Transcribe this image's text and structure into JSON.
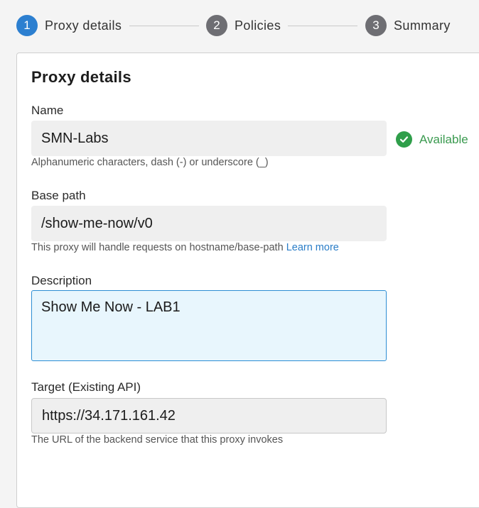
{
  "stepper": {
    "steps": [
      {
        "number": "1",
        "label": "Proxy details",
        "active": true
      },
      {
        "number": "2",
        "label": "Policies",
        "active": false
      },
      {
        "number": "3",
        "label": "Summary",
        "active": false
      }
    ]
  },
  "card": {
    "title": "Proxy details",
    "name": {
      "label": "Name",
      "value": "SMN-Labs",
      "hint": "Alphanumeric characters, dash (-) or underscore (_)",
      "status": "Available"
    },
    "base_path": {
      "label": "Base path",
      "value": "/show-me-now/v0",
      "hint": "This proxy will handle requests on hostname/base-path",
      "hint_link": "Learn more"
    },
    "description": {
      "label": "Description",
      "value": "Show Me Now - LAB1"
    },
    "target": {
      "label": "Target (Existing API)",
      "value": "https://34.171.161.42",
      "hint": "The URL of the backend service that this proxy invokes"
    }
  },
  "colors": {
    "active_step": "#2c7fd0",
    "inactive_step": "#6e6e73",
    "available": "#3a9a4f",
    "link": "#2a7dc7",
    "focus_border": "#2d8ed4"
  }
}
